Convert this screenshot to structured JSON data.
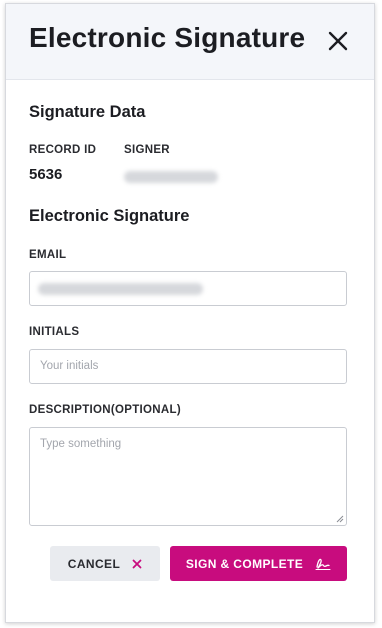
{
  "dialog": {
    "title": "Electronic Signature",
    "close_icon": "close-icon"
  },
  "signature_data": {
    "heading": "Signature Data",
    "record_id_label": "RECORD ID",
    "record_id_value": "5636",
    "signer_label": "SIGNER"
  },
  "electronic_signature": {
    "heading": "Electronic Signature",
    "email_label": "EMAIL",
    "initials_label": "INITIALS",
    "initials_placeholder": "Your initials",
    "description_label": "DESCRIPTION(OPTIONAL)",
    "description_placeholder": "Type something"
  },
  "actions": {
    "cancel_label": "CANCEL",
    "cancel_icon": "x-icon",
    "sign_label": "SIGN & COMPLETE",
    "sign_icon": "signature-icon"
  },
  "colors": {
    "accent": "#c80c7e",
    "header_bg": "#f4f6fa",
    "cancel_bg": "#e9ebef"
  }
}
